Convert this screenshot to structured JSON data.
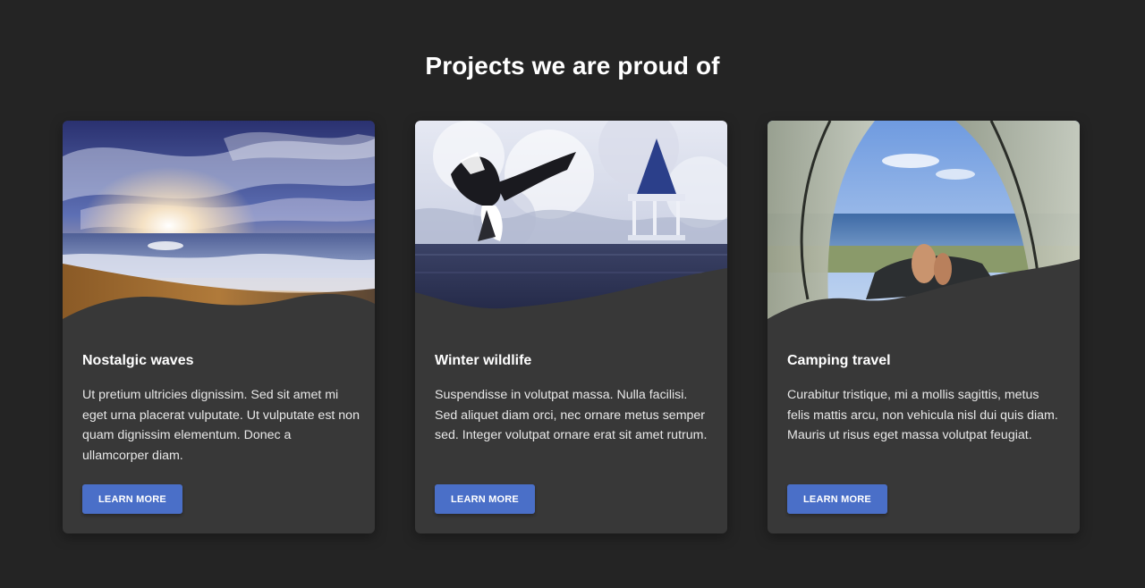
{
  "section": {
    "title": "Projects we are proud of"
  },
  "cards": [
    {
      "title": "Nostalgic waves",
      "text": "Ut pretium ultricies dignissim. Sed sit amet mi eget urna placerat vulputate. Ut vulputate est non quam dignissim elementum. Donec a ullamcorper diam.",
      "button_label": "LEARN MORE",
      "image_icon": "beach-sunset-image"
    },
    {
      "title": "Winter wildlife",
      "text": "Suspendisse in volutpat massa. Nulla facilisi. Sed aliquet diam orci, nec ornare metus semper sed. Integer volutpat ornare erat sit amet rutrum.",
      "button_label": "LEARN MORE",
      "image_icon": "snowy-lake-bird-image"
    },
    {
      "title": "Camping travel",
      "text": "Curabitur tristique, mi a mollis sagittis, metus felis mattis arcu, non vehicula nisl dui quis diam. Mauris ut risus eget massa volutpat feugiat.",
      "button_label": "LEARN MORE",
      "image_icon": "tent-ocean-view-image"
    }
  ],
  "colors": {
    "background": "#242424",
    "card": "#383838",
    "button": "#4a6fc8",
    "text": "#ffffff"
  }
}
